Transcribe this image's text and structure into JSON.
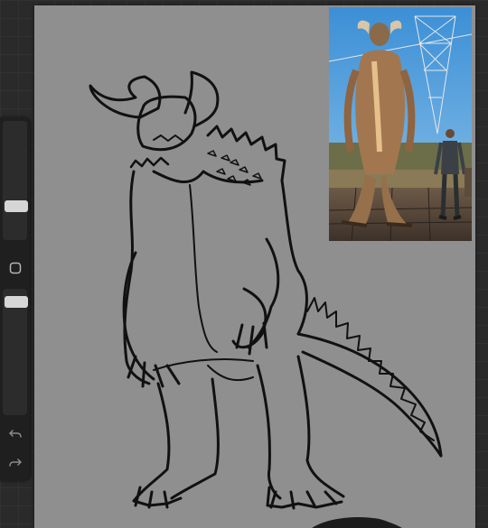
{
  "app": {
    "name": "drawing-app",
    "canvas_color": "#8f8f8f",
    "background_color": "#2a2a2a"
  },
  "toolbar": {
    "brush_size": 0.75,
    "brush_opacity": 0.95,
    "modify_button_icon": "square-icon",
    "undo_icon": "undo-arrow-icon",
    "redo_icon": "redo-arrow-icon"
  },
  "canvas": {
    "content": "sketch-drawing",
    "reference_image": "photo-reference"
  }
}
